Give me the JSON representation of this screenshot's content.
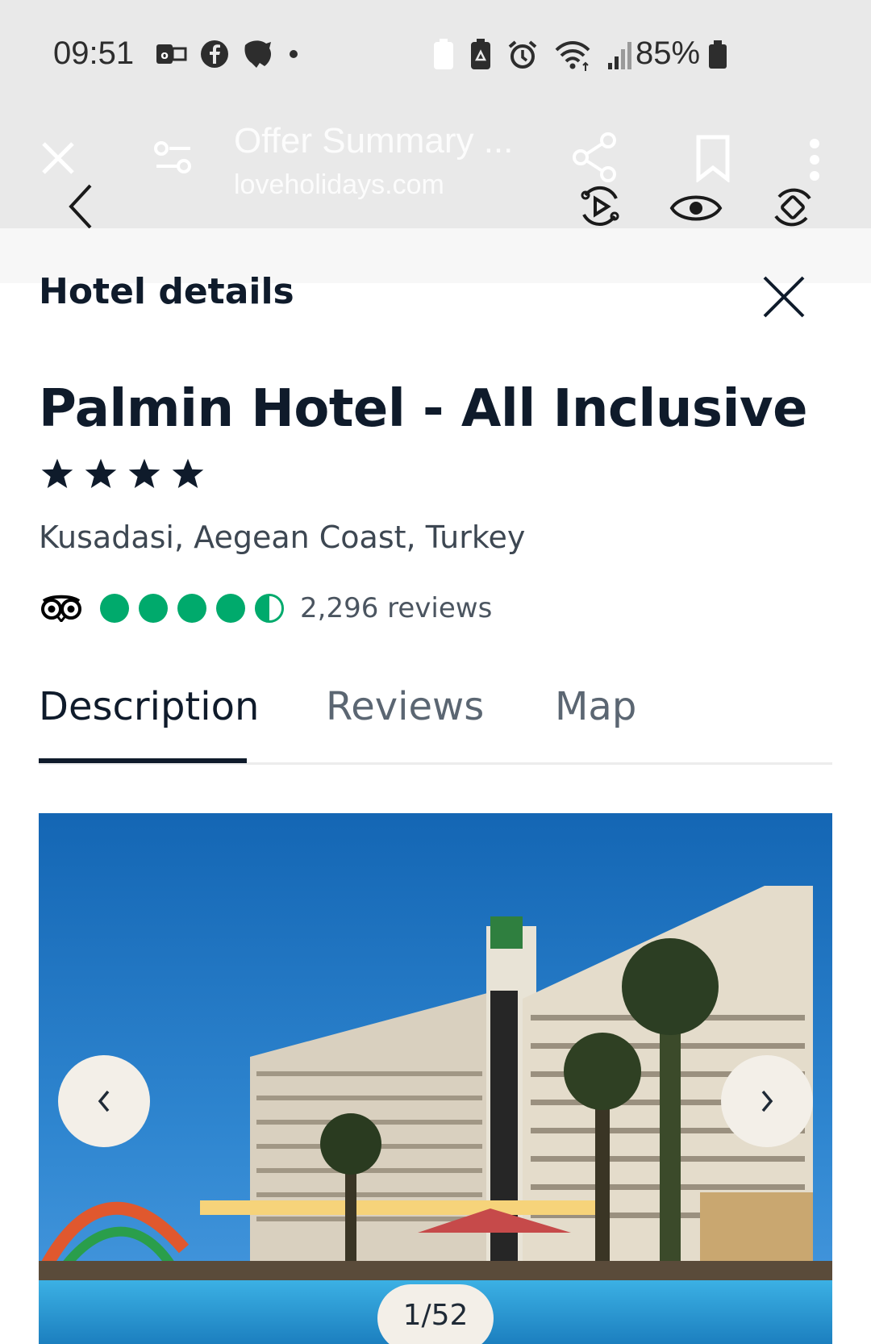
{
  "status_bar": {
    "time": "09:51",
    "battery": "85%"
  },
  "browser": {
    "faded_title": "Offer Summary ...",
    "faded_url": "loveholidays.com"
  },
  "panel": {
    "section_title": "Hotel details",
    "hotel_name": "Palmin Hotel - All Inclusive",
    "star_rating": 4,
    "location": "Kusadasi, Aegean Coast, Turkey",
    "tripadvisor_rating": 4.5,
    "reviews_count": "2,296 reviews"
  },
  "tabs": [
    {
      "label": "Description",
      "active": true
    },
    {
      "label": "Reviews",
      "active": false
    },
    {
      "label": "Map",
      "active": false
    }
  ],
  "gallery": {
    "counter": "1/52",
    "prev_label": "‹",
    "next_label": "›"
  },
  "colors": {
    "text_dark": "#0f1b2b",
    "tripadvisor_green": "#00aa6c",
    "chrome_bg": "#e9e9e9"
  }
}
